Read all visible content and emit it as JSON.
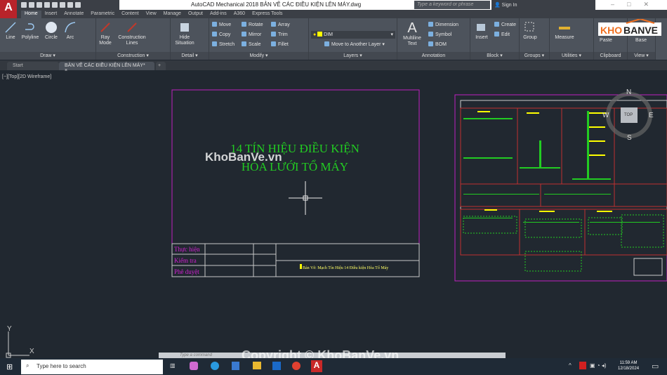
{
  "app": {
    "logo_letter": "A",
    "title": "AutoCAD Mechanical 2018    BẢN VẼ CÁC ĐIỀU KIỆN LÊN MÁY.dwg",
    "search_placeholder": "Type a keyword or phrase",
    "sign_in": "Sign In"
  },
  "ribbon_tabs": [
    "Home",
    "Insert",
    "Annotate",
    "Parametric",
    "Content",
    "View",
    "Manage",
    "Output",
    "Add-ins",
    "A360",
    "Express Tools"
  ],
  "panels": {
    "draw": "Draw ▾",
    "construction": "Construction ▾",
    "detail": "Detail ▾",
    "modify": "Modify ▾",
    "layers": "Layers ▾",
    "annotation": "Annotation",
    "block": "Block ▾",
    "groups": "Groups ▾",
    "utilities": "Utilities ▾",
    "clipboard": "Clipboard",
    "view": "View ▾"
  },
  "tools": {
    "line": "Line",
    "polyline": "Polyline",
    "circle": "Circle",
    "arc": "Arc",
    "ray_mode": "Ray Mode",
    "construction_lines": "Construction Lines",
    "hide_situation": "Hide Situation",
    "move": "Move",
    "rotate": "Rotate",
    "array": "Array",
    "copy": "Copy",
    "mirror": "Mirror",
    "trim": "Trim",
    "stretch": "Stretch",
    "scale": "Scale",
    "fillet": "Fillet",
    "layer": "DIM",
    "move_layer": "Move to Another Layer",
    "multiline_text": "Multiline Text",
    "dimension": "Dimension",
    "symbol": "Symbol",
    "bom": "BOM",
    "insert": "Insert",
    "create": "Create",
    "edit": "Edit",
    "group": "Group",
    "measure": "Measure",
    "paste": "Paste",
    "base": "Base"
  },
  "file_tabs": {
    "start": "Start",
    "drawing": "BẢN VẼ CÁC ĐIỀU KIỆN LÊN MÁY*"
  },
  "viewport_label": "[−][Top][2D Wireframe]",
  "viewcube": {
    "n": "N",
    "s": "S",
    "e": "E",
    "w": "W",
    "top": "TOP"
  },
  "drawing": {
    "title1": "14 TÍN HIỆU ĐIỀU KIỆN",
    "title2": "HÒA LƯỚI TỔ MÁY",
    "row1": "Thực hiện",
    "row2": "Kiểm tra",
    "row3": "Phê duyệt",
    "caption": "Bản Vẽ: Mạch Tín Hiệu 14 Điều kiện  Hòa Tổ Máy"
  },
  "ucs": {
    "x": "X",
    "y": "Y"
  },
  "command_placeholder": "Type a command",
  "watermark": "KhoBanVe.vn",
  "copyright": "Copyright © KhoBanVe.vn",
  "logo_text": "KHOBANVE",
  "taskbar": {
    "search": "Type here to search",
    "time": "11:59 AM",
    "date": "12/18/2024"
  },
  "colors": {
    "accent": "#b8232a",
    "magenta": "#c020c0",
    "green": "#22cc22",
    "yellow": "#ffff00"
  }
}
